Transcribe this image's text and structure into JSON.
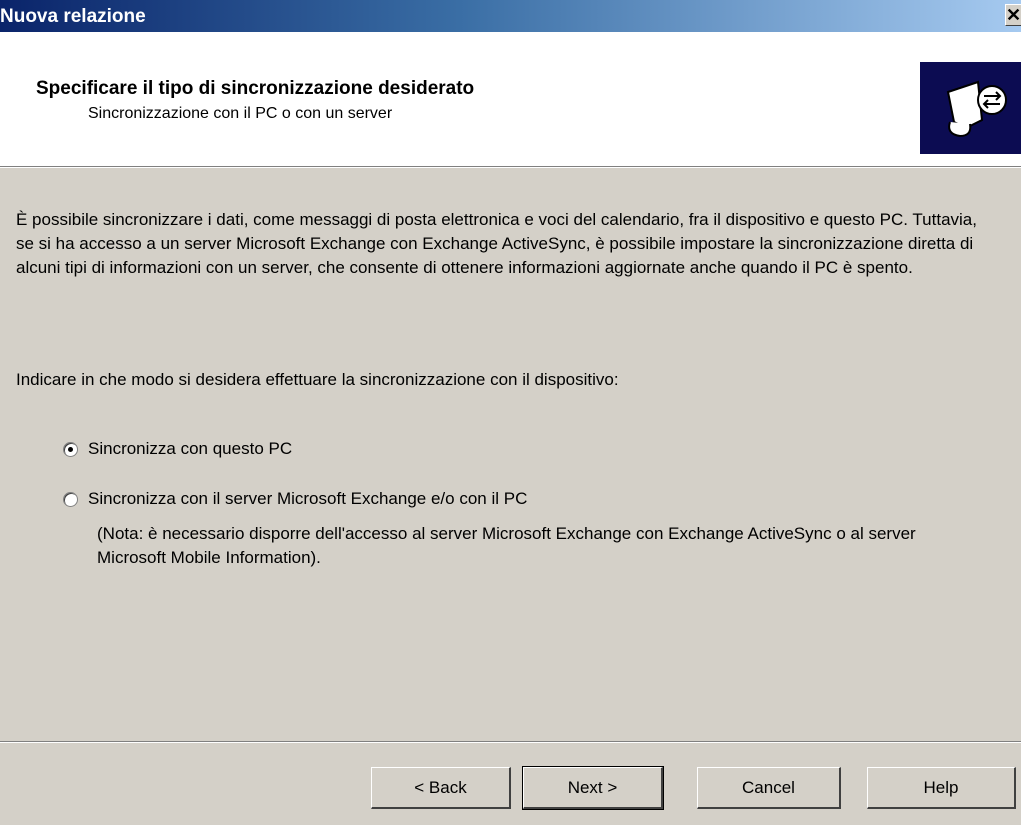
{
  "window": {
    "title": "Nuova relazione",
    "close_glyph": "✕"
  },
  "header": {
    "title": "Specificare il tipo di sincronizzazione desiderato",
    "subtitle": "Sincronizzazione con il PC o con un server",
    "icon": "sync-device-icon"
  },
  "body": {
    "description": "È possibile sincronizzare i dati, come messaggi di posta elettronica e voci del calendario, fra il dispositivo e questo PC. Tuttavia, se si ha accesso a un server Microsoft Exchange con Exchange ActiveSync, è possibile impostare la sincronizzazione diretta di alcuni tipi di informazioni con un server, che consente di ottenere informazioni aggiornate anche quando il PC è spento.",
    "prompt": "Indicare in che modo si desidera effettuare la sincronizzazione con il dispositivo:"
  },
  "options": [
    {
      "label": "Sincronizza con questo PC",
      "selected": true
    },
    {
      "label": "Sincronizza con il server Microsoft Exchange e/o con il PC",
      "selected": false
    }
  ],
  "note": "(Nota: è necessario disporre dell'accesso al server Microsoft Exchange con Exchange ActiveSync o al server Microsoft Mobile Information).",
  "buttons": {
    "back": "< Back",
    "next": "Next >",
    "cancel": "Cancel",
    "help": "Help"
  }
}
